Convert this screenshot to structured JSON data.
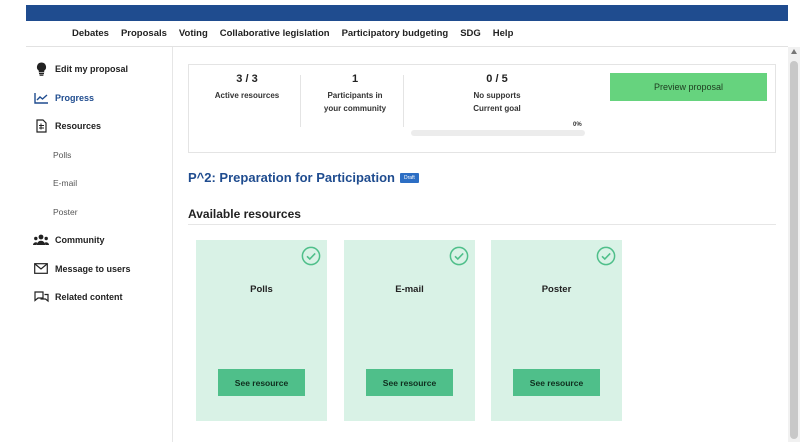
{
  "nav": [
    "Debates",
    "Proposals",
    "Voting",
    "Collaborative legislation",
    "Participatory budgeting",
    "SDG",
    "Help"
  ],
  "sidebar": {
    "edit": "Edit my proposal",
    "progress": "Progress",
    "resources": "Resources",
    "sub": [
      "Polls",
      "E-mail",
      "Poster"
    ],
    "community": "Community",
    "message": "Message to users",
    "related": "Related content"
  },
  "stats": {
    "resources_value": "3 / 3",
    "resources_label": "Active resources",
    "participants_value": "1",
    "participants_label_1": "Participants in",
    "participants_label_2": "your community",
    "supports_value": "0 / 5",
    "supports_label": "No supports",
    "goal_label": "Current goal",
    "progress_text": "0%",
    "progress_percent": 0
  },
  "preview_button": "Preview proposal",
  "proposal": {
    "title": "P^2: Preparation for Participation",
    "badge": "Draft"
  },
  "section_title": "Available resources",
  "cards": [
    {
      "title": "Polls",
      "button": "See resource"
    },
    {
      "title": "E-mail",
      "button": "See resource"
    },
    {
      "title": "Poster",
      "button": "See resource"
    }
  ],
  "colors": {
    "brand": "#1f4c8f",
    "accent_green": "#66d37e",
    "card_bg": "#d9f2e6",
    "card_button": "#4fbf8a"
  }
}
